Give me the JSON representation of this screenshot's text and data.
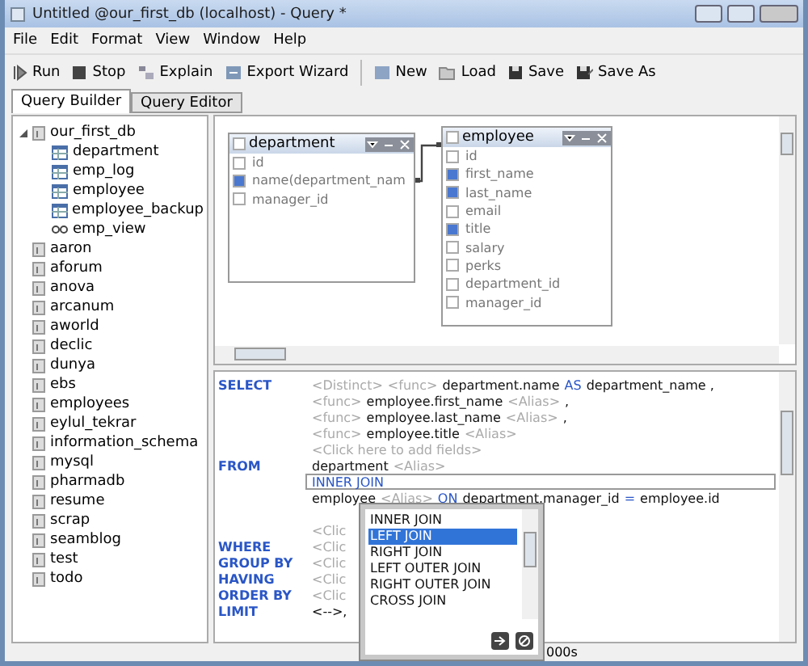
{
  "window": {
    "title": "Untitled @our_first_db (localhost) - Query *"
  },
  "menu": [
    "File",
    "Edit",
    "Format",
    "View",
    "Window",
    "Help"
  ],
  "toolbar": [
    {
      "label": "Run",
      "kind": "run"
    },
    {
      "label": "Stop",
      "kind": "stop"
    },
    {
      "label": "Explain",
      "kind": "explain"
    },
    {
      "label": "Export Wizard",
      "kind": "export"
    },
    {
      "label": "New",
      "kind": "new"
    },
    {
      "label": "Load",
      "kind": "load"
    },
    {
      "label": "Save",
      "kind": "save"
    },
    {
      "label": "Save As",
      "kind": "saveas"
    }
  ],
  "tabs": [
    {
      "label": "Query Builder",
      "selected": true
    },
    {
      "label": "Query Editor",
      "selected": false
    }
  ],
  "tree": [
    {
      "label": "our_first_db",
      "kind": "database",
      "expanded": true,
      "children": [
        {
          "label": "department",
          "kind": "table"
        },
        {
          "label": "emp_log",
          "kind": "table"
        },
        {
          "label": "employee",
          "kind": "table"
        },
        {
          "label": "employee_backup",
          "kind": "table"
        },
        {
          "label": "emp_view",
          "kind": "view"
        }
      ]
    },
    {
      "label": "aaron",
      "kind": "database"
    },
    {
      "label": "aforum",
      "kind": "database"
    },
    {
      "label": "anova",
      "kind": "database"
    },
    {
      "label": "arcanum",
      "kind": "database"
    },
    {
      "label": "aworld",
      "kind": "database"
    },
    {
      "label": "declic",
      "kind": "database"
    },
    {
      "label": "dunya",
      "kind": "database"
    },
    {
      "label": "ebs",
      "kind": "database"
    },
    {
      "label": "employees",
      "kind": "database"
    },
    {
      "label": "eylul_tekrar",
      "kind": "database"
    },
    {
      "label": "information_schema",
      "kind": "database"
    },
    {
      "label": "mysql",
      "kind": "database"
    },
    {
      "label": "pharmadb",
      "kind": "database"
    },
    {
      "label": "resume",
      "kind": "database"
    },
    {
      "label": "scrap",
      "kind": "database"
    },
    {
      "label": "seamblog",
      "kind": "database"
    },
    {
      "label": "test",
      "kind": "database"
    },
    {
      "label": "todo",
      "kind": "database"
    }
  ],
  "diagram": {
    "tables": [
      {
        "name": "department",
        "checked": false,
        "fields": [
          {
            "name": "id",
            "checked": false
          },
          {
            "name": "name(department_nam",
            "checked": true
          },
          {
            "name": "manager_id",
            "checked": false
          }
        ]
      },
      {
        "name": "employee",
        "checked": false,
        "fields": [
          {
            "name": "id",
            "checked": false
          },
          {
            "name": "first_name",
            "checked": true
          },
          {
            "name": "last_name",
            "checked": true
          },
          {
            "name": "email",
            "checked": false
          },
          {
            "name": "title",
            "checked": true
          },
          {
            "name": "salary",
            "checked": false
          },
          {
            "name": "perks",
            "checked": false
          },
          {
            "name": "department_id",
            "checked": false
          },
          {
            "name": "manager_id",
            "checked": false
          }
        ]
      }
    ]
  },
  "sql": [
    {
      "clause": "SELECT",
      "tokens": [
        {
          "kind": "hint",
          "text": "<Distinct>"
        },
        {
          "kind": "hint",
          "text": "<func>"
        },
        {
          "kind": "text",
          "text": "department.name"
        },
        {
          "kind": "keyword",
          "text": "AS"
        },
        {
          "kind": "text",
          "text": "department_name ,"
        }
      ]
    },
    {
      "tokens": [
        {
          "kind": "hint",
          "text": "<func>"
        },
        {
          "kind": "text",
          "text": "employee.first_name"
        },
        {
          "kind": "hint",
          "text": "<Alias>"
        },
        {
          "kind": "text",
          "text": ","
        }
      ]
    },
    {
      "tokens": [
        {
          "kind": "hint",
          "text": "<func>"
        },
        {
          "kind": "text",
          "text": "employee.last_name"
        },
        {
          "kind": "hint",
          "text": "<Alias>"
        },
        {
          "kind": "text",
          "text": ","
        }
      ]
    },
    {
      "tokens": [
        {
          "kind": "hint",
          "text": "<func>"
        },
        {
          "kind": "text",
          "text": "employee.title"
        },
        {
          "kind": "hint",
          "text": "<Alias>"
        }
      ]
    },
    {
      "tokens": [
        {
          "kind": "hint",
          "text": "<Click here to add fields>"
        }
      ]
    },
    {
      "clause": "FROM",
      "tokens": [
        {
          "kind": "text",
          "text": "department"
        },
        {
          "kind": "hint",
          "text": "<Alias>"
        }
      ]
    },
    {
      "boxed": true,
      "tokens": [
        {
          "kind": "keyword",
          "text": "INNER JOIN"
        }
      ]
    },
    {
      "tokens": [
        {
          "kind": "text",
          "text": "employee"
        },
        {
          "kind": "hint",
          "text": "<Alias>"
        },
        {
          "kind": "keyword",
          "text": "ON"
        },
        {
          "kind": "text",
          "text": "department.manager_id"
        },
        {
          "kind": "keyword",
          "text": "="
        },
        {
          "kind": "text",
          "text": "employee.id"
        }
      ]
    },
    {
      "tokens": [
        {
          "kind": "hint",
          "text": "<Clic"
        }
      ]
    },
    {
      "clause": "WHERE",
      "tokens": [
        {
          "kind": "hint",
          "text": "<Clic"
        }
      ]
    },
    {
      "clause": "GROUP BY",
      "tokens": [
        {
          "kind": "hint",
          "text": "<Clic"
        }
      ]
    },
    {
      "clause": "HAVING",
      "tokens": [
        {
          "kind": "hint",
          "text": "<Clic"
        }
      ]
    },
    {
      "clause": "ORDER BY",
      "tokens": [
        {
          "kind": "hint",
          "text": "<Clic"
        }
      ]
    },
    {
      "clause": "LIMIT",
      "tokens": [
        {
          "kind": "text",
          "text": "<-->,"
        }
      ]
    }
  ],
  "join_menu": {
    "options": [
      {
        "label": "INNER JOIN",
        "selected": false
      },
      {
        "label": "LEFT JOIN",
        "selected": true
      },
      {
        "label": "RIGHT JOIN",
        "selected": false
      },
      {
        "label": "LEFT OUTER JOIN",
        "selected": false
      },
      {
        "label": "RIGHT OUTER JOIN",
        "selected": false
      },
      {
        "label": "CROSS JOIN",
        "selected": false
      }
    ]
  },
  "status_bar": {
    "text": "000s"
  }
}
